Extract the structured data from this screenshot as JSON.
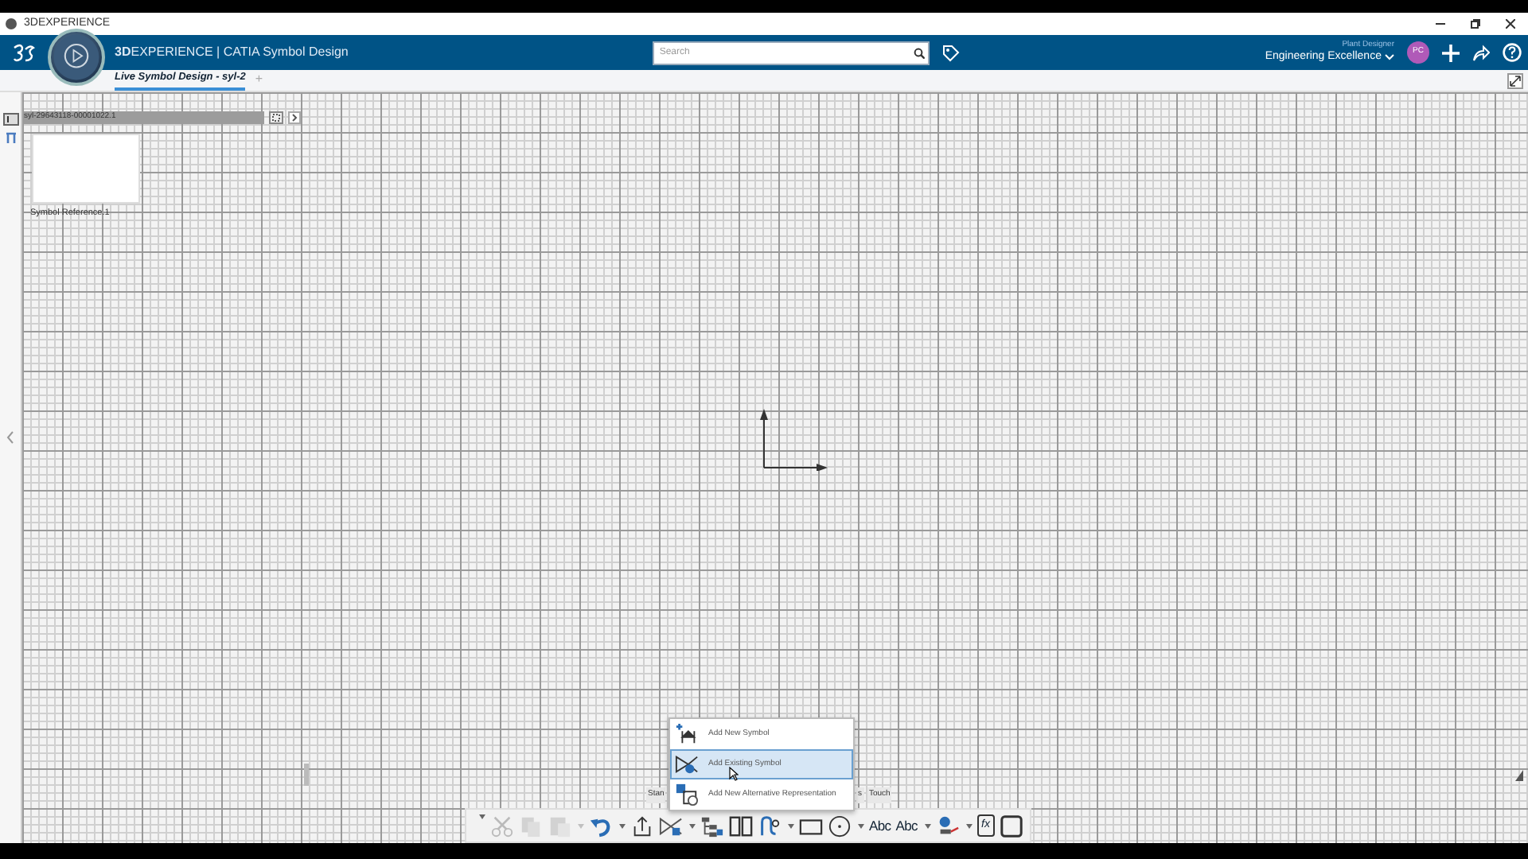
{
  "window": {
    "title": "3DEXPERIENCE"
  },
  "header": {
    "brand": "**3D**EXPERIENCE | CATIA Symbol Design",
    "search": {
      "placeholder": "Search"
    },
    "role": "Plant Designer",
    "collab_space": "Engineering Excellence",
    "avatar": "PC"
  },
  "tabs": [
    {
      "label": "Live Symbol Design - syl-2",
      "selected": true
    }
  ],
  "add_tab": "+",
  "tree": {
    "root": "syl-29643118-00001022.1",
    "thumbnail_label": "Symbol Reference.1"
  },
  "context_menu": [
    {
      "label": "Add New Symbol",
      "kind": "new",
      "selected": false
    },
    {
      "label": "Add Existing Symbol",
      "kind": "existing",
      "selected": true
    },
    {
      "label": "Add New Alternative Representation",
      "kind": "alternative",
      "selected": false
    }
  ],
  "section_tabs": [
    "Stan",
    "s",
    "Touch"
  ],
  "toolbar": [
    {
      "kind": "cut",
      "disabled": true,
      "dropdown": false
    },
    {
      "kind": "copy",
      "disabled": true,
      "dropdown": false
    },
    {
      "kind": "paste",
      "disabled": true,
      "dropdown": true
    },
    {
      "kind": "undo",
      "disabled": false,
      "dropdown": true
    },
    {
      "kind": "export",
      "disabled": false,
      "dropdown": false
    },
    {
      "kind": "symbol",
      "disabled": false,
      "dropdown": true
    },
    {
      "kind": "tree",
      "disabled": false,
      "dropdown": false
    },
    {
      "kind": "split",
      "disabled": false,
      "dropdown": false
    },
    {
      "kind": "route",
      "disabled": false,
      "dropdown": true
    },
    {
      "kind": "rectangle",
      "disabled": false,
      "dropdown": false
    },
    {
      "kind": "circle",
      "disabled": false,
      "dropdown": true
    },
    {
      "kind": "text-pointer",
      "label": "Abc",
      "disabled": false,
      "dropdown": false
    },
    {
      "kind": "text",
      "label": "Abc",
      "disabled": false,
      "dropdown": true
    },
    {
      "kind": "pin",
      "disabled": false,
      "dropdown": true
    },
    {
      "kind": "formula",
      "label": "fx",
      "disabled": false,
      "dropdown": false
    },
    {
      "kind": "frame",
      "disabled": false,
      "dropdown": false
    }
  ]
}
